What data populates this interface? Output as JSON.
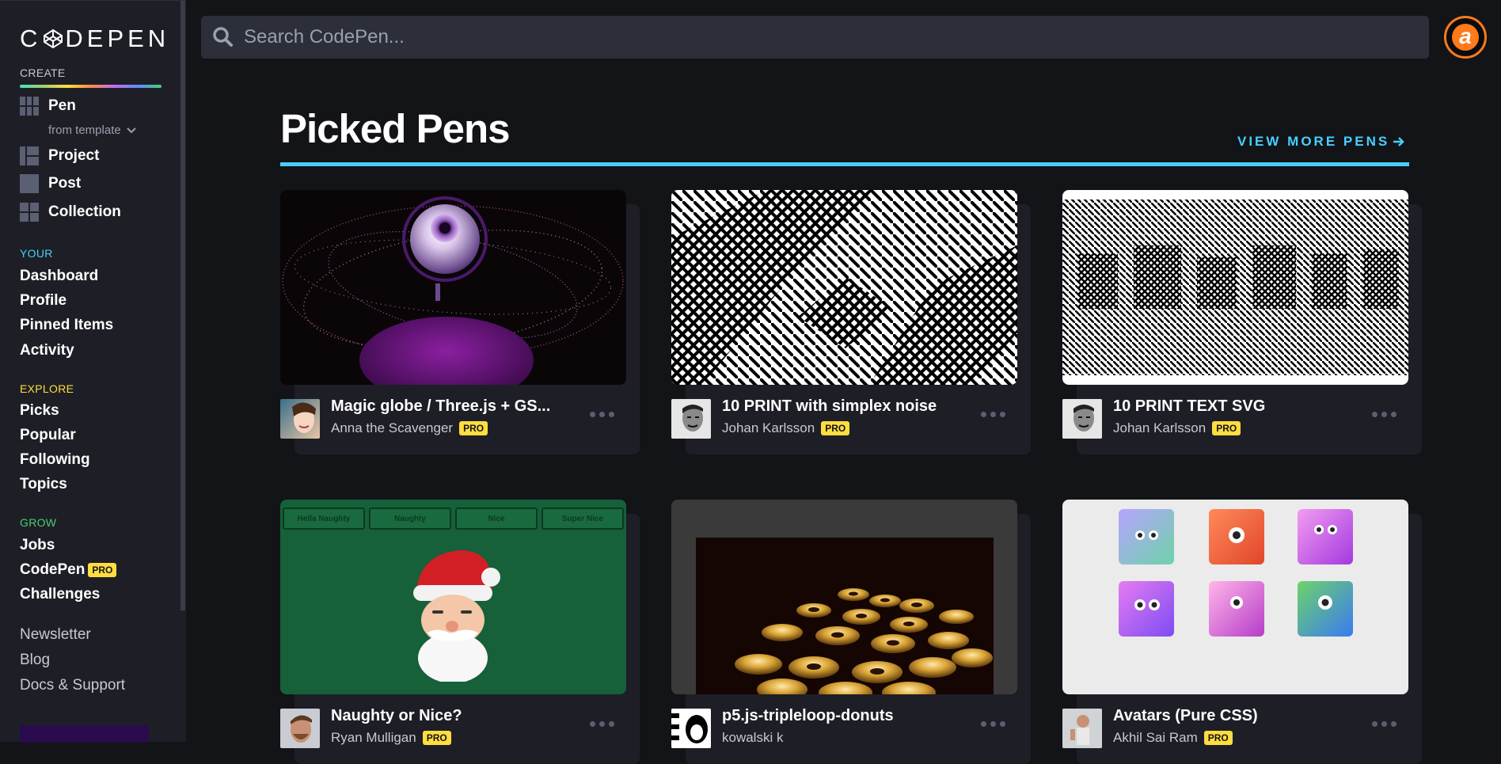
{
  "brand": {
    "name": "CODEPEN"
  },
  "sidebar": {
    "create_label": "CREATE",
    "create_items": [
      {
        "label": "Pen",
        "icon": "pen-icon"
      },
      {
        "label": "Project",
        "icon": "project-icon"
      },
      {
        "label": "Post",
        "icon": "post-icon"
      },
      {
        "label": "Collection",
        "icon": "collection-icon"
      }
    ],
    "from_template": "from template",
    "your_label": "YOUR",
    "your_items": [
      "Dashboard",
      "Profile",
      "Pinned Items",
      "Activity"
    ],
    "explore_label": "EXPLORE",
    "explore_items": [
      "Picks",
      "Popular",
      "Following",
      "Topics"
    ],
    "grow_label": "GROW",
    "grow_items": [
      "Jobs",
      "CodePen",
      "Challenges"
    ],
    "pro_badge": "PRO",
    "misc_items": [
      "Newsletter",
      "Blog",
      "Docs & Support"
    ],
    "colors": {
      "your": "#47cfff",
      "explore": "#ffdd40",
      "grow": "#47cf73"
    }
  },
  "search": {
    "placeholder": "Search CodePen..."
  },
  "user": {
    "avatar_letter": "a"
  },
  "main": {
    "title": "Picked Pens",
    "view_more": "VIEW MORE PENS"
  },
  "pens": [
    {
      "title": "Magic globe / Three.js + GS...",
      "author": "Anna the Scavenger",
      "pro": "PRO",
      "thumb": "galaxy-eye"
    },
    {
      "title": "10 PRINT with simplex noise",
      "author": "Johan Karlsson",
      "pro": "PRO",
      "thumb": "maze"
    },
    {
      "title": "10 PRINT TEXT SVG",
      "author": "Johan Karlsson",
      "pro": "PRO",
      "thumb": "maze-text"
    },
    {
      "title": "Naughty or Nice?",
      "author": "Ryan Mulligan",
      "pro": "PRO",
      "thumb": "santa",
      "buttons": [
        "Hella Naughty",
        "Naughty",
        "Nice",
        "Super Nice"
      ]
    },
    {
      "title": "p5.js-tripleloop-donuts",
      "author": "kowalski k",
      "pro": "",
      "thumb": "donuts"
    },
    {
      "title": "Avatars (Pure CSS)",
      "author": "Akhil Sai Ram",
      "pro": "PRO",
      "thumb": "avatars"
    }
  ]
}
